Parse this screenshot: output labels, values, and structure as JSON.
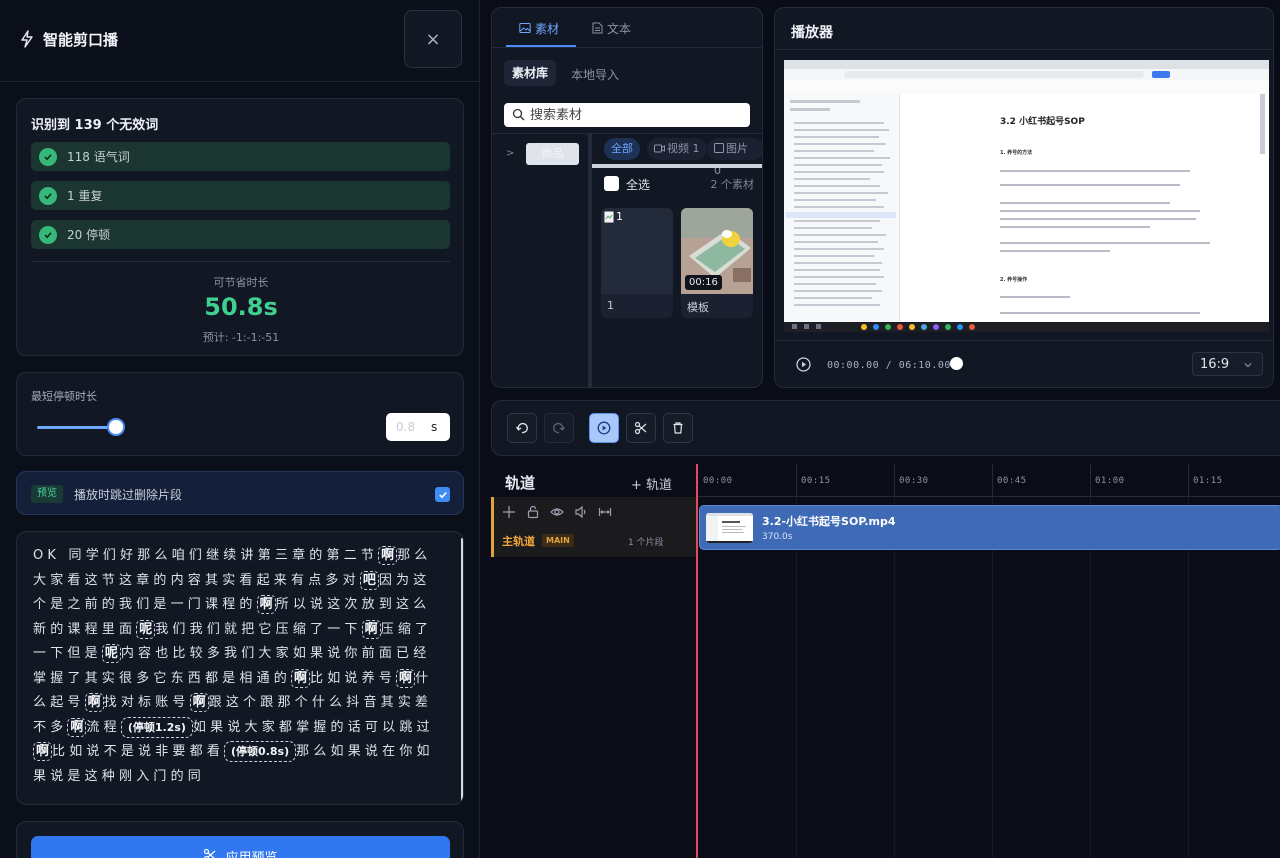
{
  "app": {
    "title": "智能剪口播",
    "close_icon": "×"
  },
  "stats": {
    "title": "识别到 139 个无效词",
    "rows": [
      {
        "label": "118 语气词"
      },
      {
        "label": "1 重复"
      },
      {
        "label": "20 停顿"
      }
    ],
    "save_label": "可节省时长",
    "save_value": "50.8s",
    "estimate": "预计: -1:-1:-51"
  },
  "pause": {
    "label": "最短停顿时长",
    "value": "0.8",
    "unit": "s",
    "slider_level": 0.19
  },
  "preview_opt": {
    "badge": "预览",
    "text": "播放时跳过删除片段",
    "checked": true
  },
  "transcript": {
    "segments": [
      {
        "t": "OK 同学们好那么咱们继续讲第三章的第二节"
      },
      {
        "tag": "啊"
      },
      {
        "t": "那么大家看这节这章的内容其实看起来有点多对"
      },
      {
        "tag": "吧"
      },
      {
        "t": "因为这个是之前的我们是一门课程的"
      },
      {
        "tag": "啊"
      },
      {
        "t": "所以说这次放到这么新的课程里面"
      },
      {
        "tag": "呢"
      },
      {
        "t": "我们我们就把它压缩了一下"
      },
      {
        "tag": "啊"
      },
      {
        "t": "压缩了一下但是"
      },
      {
        "tag": "呢"
      },
      {
        "t": "内容也比较多我们大家如果说你前面已经掌握了其实很多它东西都是相通的"
      },
      {
        "tag": "啊"
      },
      {
        "t": "比如说养号"
      },
      {
        "tag": "啊"
      },
      {
        "t": "什么起号"
      },
      {
        "tag": "啊"
      },
      {
        "t": "找对标账号"
      },
      {
        "tag": "啊"
      },
      {
        "t": "跟这个跟那个什么抖音其实差不多"
      },
      {
        "tag": "啊"
      },
      {
        "t": "流程"
      },
      {
        "pause": "(停顿1.2s)"
      },
      {
        "t": "如果说大家都掌握的话可以跳过"
      },
      {
        "tag": "啊"
      },
      {
        "t": "比如说不是说非要都看"
      },
      {
        "pause": "(停顿0.8s)"
      },
      {
        "t": "那么如果说在你如果说是这种刚入门的同"
      }
    ]
  },
  "apply": {
    "label": "应用预览"
  },
  "materials": {
    "tabs": [
      {
        "label": "素材",
        "active": true
      },
      {
        "label": "文本"
      }
    ],
    "subtabs": {
      "active": "素材库",
      "other": "本地导入"
    },
    "search_placeholder": "搜索素材",
    "folder": "商品",
    "filters": [
      {
        "label": "全部"
      },
      {
        "label": "视频 1"
      },
      {
        "label": "图片 0"
      }
    ],
    "select_all": "全选",
    "count": "2 个素材",
    "items": [
      {
        "name": "1",
        "alt": "1"
      },
      {
        "name": "模板",
        "duration": "00:16"
      }
    ]
  },
  "player": {
    "title": "播放器",
    "time": "00:00.00 / 06:10.00",
    "ratio": "16:9",
    "doc": {
      "heading": "3.2 小红书起号SOP",
      "section1": "1. 养号的方法",
      "section2": "2. 养号操作"
    }
  },
  "toolbar": {
    "buttons": [
      "undo",
      "redo",
      "play",
      "cut",
      "delete"
    ]
  },
  "timeline": {
    "label": "轨道",
    "add": "+ 轨道",
    "track_name": "主轨道",
    "track_badge": "MAIN",
    "clip_count": "1 个片段",
    "ticks": [
      "00:00",
      "00:15",
      "00:30",
      "00:45",
      "01:00",
      "01:15"
    ],
    "clip": {
      "name": "3.2-小红书起号SOP.mp4",
      "duration": "370.0s"
    }
  }
}
